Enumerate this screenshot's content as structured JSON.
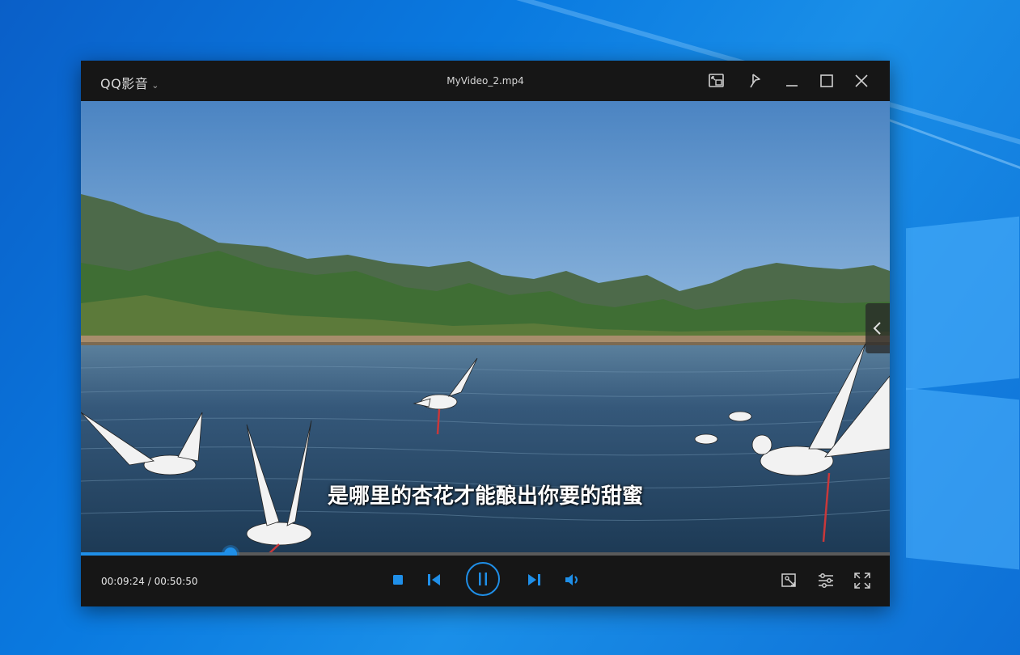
{
  "app": {
    "brand": "QQ影音",
    "file_title": "MyVideo_2.mp4"
  },
  "titlebar_icons": [
    "mini-mode-icon",
    "pin-icon",
    "minimize-icon",
    "maximize-icon",
    "close-icon"
  ],
  "video": {
    "subtitle": "是哪里的杏花才能酿出你要的甜蜜"
  },
  "playback": {
    "current_time": "00:09:24",
    "separator": " / ",
    "total_time": "00:50:50",
    "progress_fraction": 0.185
  },
  "controls": {
    "left_icons": [
      "stop-icon",
      "previous-icon",
      "pause-icon",
      "next-icon",
      "volume-icon"
    ],
    "right_icons": [
      "screenshot-icon",
      "settings-icon",
      "fullscreen-icon"
    ]
  },
  "colors": {
    "accent": "#1f8fe8",
    "window_bg": "#161616",
    "desktop_bg": "#0a7ae0"
  }
}
